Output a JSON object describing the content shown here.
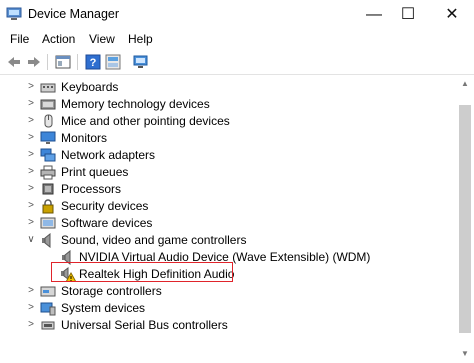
{
  "window": {
    "title": "Device Manager",
    "minimize_glyph": "—",
    "maximize_glyph": "☐",
    "close_glyph": "✕"
  },
  "menubar": {
    "items": [
      "File",
      "Action",
      "View",
      "Help"
    ]
  },
  "toolbar": {
    "buttons": [
      "back-arrow-icon",
      "forward-arrow-icon",
      "properties-icon",
      "help-icon",
      "update-driver-icon",
      "scan-hardware-icon"
    ]
  },
  "tree": {
    "rows": [
      {
        "label": "Keyboards",
        "icon": "keyboard-icon",
        "state": "collapsed"
      },
      {
        "label": "Memory technology devices",
        "icon": "memory-device-icon",
        "state": "collapsed"
      },
      {
        "label": "Mice and other pointing devices",
        "icon": "mouse-icon",
        "state": "collapsed"
      },
      {
        "label": "Monitors",
        "icon": "monitor-icon",
        "state": "collapsed"
      },
      {
        "label": "Network adapters",
        "icon": "network-adapter-icon",
        "state": "collapsed"
      },
      {
        "label": "Print queues",
        "icon": "printer-icon",
        "state": "collapsed"
      },
      {
        "label": "Processors",
        "icon": "processor-icon",
        "state": "collapsed"
      },
      {
        "label": "Security devices",
        "icon": "security-device-icon",
        "state": "collapsed"
      },
      {
        "label": "Software devices",
        "icon": "software-device-icon",
        "state": "collapsed"
      },
      {
        "label": "Sound, video and game controllers",
        "icon": "speaker-icon",
        "state": "expanded"
      },
      {
        "label": "NVIDIA Virtual Audio Device (Wave Extensible) (WDM)",
        "icon": "speaker-icon",
        "state": "child"
      },
      {
        "label": "Realtek High Definition Audio",
        "icon": "speaker-warning-icon",
        "state": "child"
      },
      {
        "label": "Storage controllers",
        "icon": "storage-controller-icon",
        "state": "collapsed"
      },
      {
        "label": "System devices",
        "icon": "system-device-icon",
        "state": "collapsed"
      },
      {
        "label": "Universal Serial Bus controllers",
        "icon": "usb-icon",
        "state": "collapsed"
      }
    ]
  },
  "colors": {
    "highlight_border": "#e0242b",
    "warning": "#f2c200",
    "scrollbar_thumb": "#cdcdcd"
  }
}
